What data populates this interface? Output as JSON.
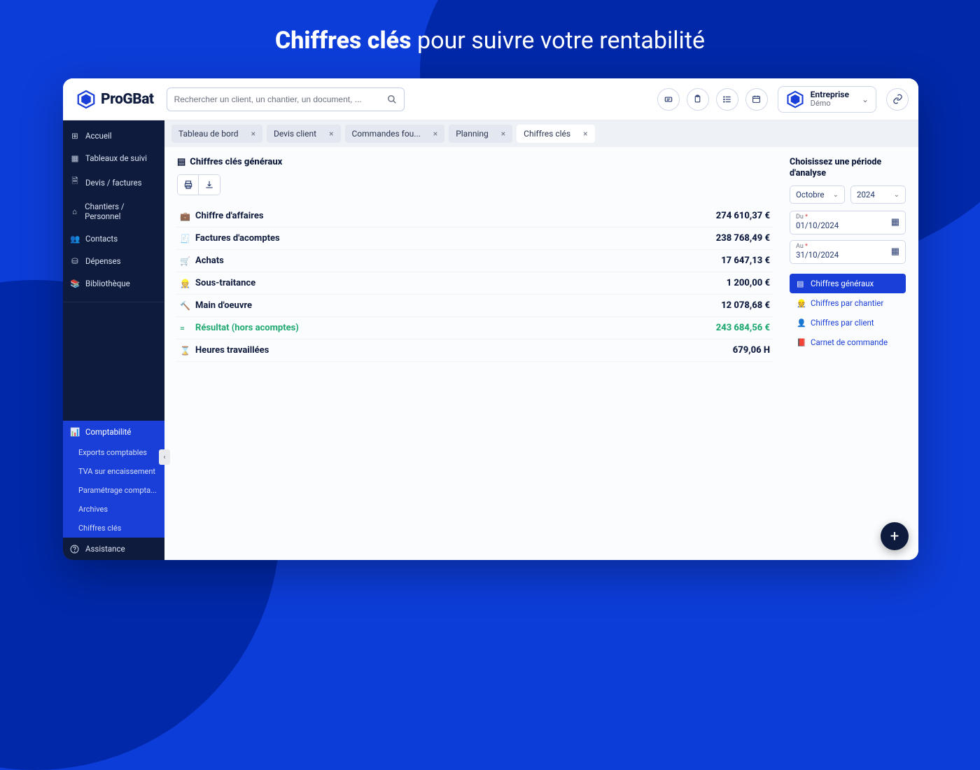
{
  "hero": {
    "bold": "Chiffres clés",
    "rest": " pour suivre votre rentabilité"
  },
  "logo": "ProGBat",
  "search": {
    "placeholder": "Rechercher un client, un chantier, un document, ..."
  },
  "company": {
    "line1": "Entreprise",
    "line2": "Démo"
  },
  "sidebar": {
    "items": [
      {
        "icon": "⊞",
        "label": "Accueil"
      },
      {
        "icon": "▦",
        "label": "Tableaux de suivi"
      },
      {
        "icon": "🗎",
        "label": "Devis / factures"
      },
      {
        "icon": "⌂",
        "label": "Chantiers / Personnel"
      },
      {
        "icon": "👥",
        "label": "Contacts"
      },
      {
        "icon": "⛁",
        "label": "Dépenses"
      },
      {
        "icon": "📚",
        "label": "Bibliothèque"
      }
    ],
    "active": {
      "icon": "📊",
      "label": "Comptabilité"
    },
    "subs": [
      "Exports comptables",
      "TVA sur encaissement",
      "Paramétrage compta...",
      "Archives",
      "Chiffres clés"
    ],
    "assistance": {
      "icon": "?",
      "label": "Assistance"
    }
  },
  "tabs": [
    {
      "label": "Tableau de bord",
      "active": false
    },
    {
      "label": "Devis client",
      "active": false
    },
    {
      "label": "Commandes fou...",
      "active": false
    },
    {
      "label": "Planning",
      "active": false
    },
    {
      "label": "Chiffres clés",
      "active": true
    }
  ],
  "section_title": "Chiffres clés généraux",
  "stats": [
    {
      "icon": "💼",
      "label": "Chiffre d'affaires",
      "value": "274 610,37 €",
      "green": false
    },
    {
      "icon": "🧾",
      "label": "Factures d'acomptes",
      "value": "238 768,49 €",
      "green": false
    },
    {
      "icon": "🛒",
      "label": "Achats",
      "value": "17 647,13 €",
      "green": false
    },
    {
      "icon": "👷",
      "label": "Sous-traitance",
      "value": "1 200,00 €",
      "green": false
    },
    {
      "icon": "🔨",
      "label": "Main d'oeuvre",
      "value": "12 078,68 €",
      "green": false
    },
    {
      "icon": "=",
      "label": "Résultat (hors acomptes)",
      "value": "243 684,56 €",
      "green": true
    },
    {
      "icon": "⌛",
      "label": "Heures travaillées",
      "value": "679,06 H",
      "green": false
    }
  ],
  "period": {
    "title": "Choisissez une période d'analyse",
    "month": "Octobre",
    "year": "2024",
    "from_label": "Du",
    "from_value": "01/10/2024",
    "to_label": "Au",
    "to_value": "31/10/2024"
  },
  "filters": [
    {
      "icon": "▤",
      "label": "Chiffres généraux",
      "active": true
    },
    {
      "icon": "👷",
      "label": "Chiffres par chantier",
      "active": false
    },
    {
      "icon": "👤",
      "label": "Chiffres par client",
      "active": false
    },
    {
      "icon": "📕",
      "label": "Carnet de commande",
      "active": false
    }
  ]
}
